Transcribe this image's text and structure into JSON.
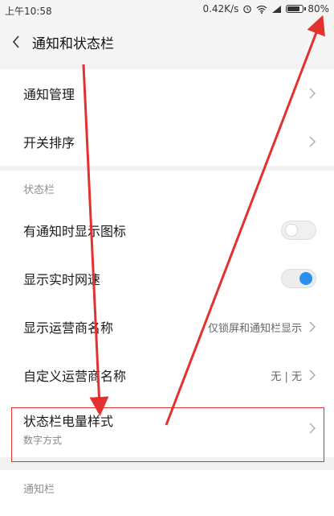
{
  "status_bar": {
    "time": "上午10:58",
    "network_speed": "0.42K/s",
    "battery_text": "80%",
    "battery_level": 0.8,
    "icons": [
      "alarm-icon",
      "wifi-icon",
      "signal-icon",
      "battery-icon"
    ]
  },
  "header": {
    "title": "通知和状态栏",
    "back_icon": "chevron-left-icon"
  },
  "group1": {
    "items": [
      {
        "label": "通知管理"
      },
      {
        "label": "开关排序"
      }
    ]
  },
  "status_section": {
    "label": "状态栏",
    "items": [
      {
        "label": "有通知时显示图标",
        "toggle": "off"
      },
      {
        "label": "显示实时网速",
        "toggle": "on"
      },
      {
        "label": "显示运营商名称",
        "value": "仅锁屏和通知栏显示"
      },
      {
        "label": "自定义运营商名称",
        "value": "无 | 无"
      },
      {
        "label": "状态栏电量样式",
        "sub": "数字方式"
      }
    ]
  },
  "notify_section": {
    "label": "通知栏"
  },
  "colors": {
    "accent": "#2a90f0",
    "annotation": "#e53030"
  }
}
